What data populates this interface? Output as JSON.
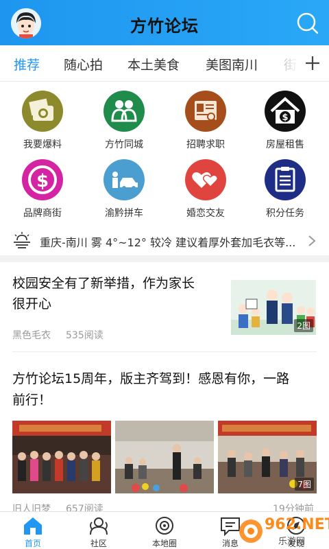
{
  "header": {
    "title": "方竹论坛"
  },
  "tabs": [
    {
      "label": "推荐",
      "active": true
    },
    {
      "label": "随心拍",
      "active": false
    },
    {
      "label": "本土美食",
      "active": false
    },
    {
      "label": "美图南川",
      "active": false
    },
    {
      "label": "街",
      "active": false
    }
  ],
  "grid": [
    {
      "label": "我要爆料",
      "icon": "camera-icon",
      "color": "#8c8a2c"
    },
    {
      "label": "方竹同城",
      "icon": "people-icon",
      "color": "#1f8c4b"
    },
    {
      "label": "招聘求职",
      "icon": "resume-icon",
      "color": "#a54e1c"
    },
    {
      "label": "房屋租售",
      "icon": "house-dollar-icon",
      "color": "#111111"
    },
    {
      "label": "品牌商街",
      "icon": "dollar-coin-icon",
      "color": "#d424a4"
    },
    {
      "label": "渝黔拼车",
      "icon": "carpool-icon",
      "color": "#4a9fd0"
    },
    {
      "label": "婚恋交友",
      "icon": "hearts-icon",
      "color": "#e0443e"
    },
    {
      "label": "积分任务",
      "icon": "task-list-icon",
      "color": "#1e2e86"
    }
  ],
  "weather": {
    "text": "重庆-南川 雾 4°~12° 较冷 建议着厚外套加毛衣等..."
  },
  "posts": [
    {
      "title_line1": "校园安全有了新举措，作为家长",
      "title_line2": "很开心",
      "author": "黑色毛衣",
      "reads": "535阅读",
      "image_count": "2图"
    },
    {
      "title_line1": "方竹论坛15周年，版主齐驾到！感恩有你，一路",
      "title_line2": "前行！",
      "author": "旧人旧梦",
      "reads": "657阅读",
      "time": "19分钟前",
      "image_count": "7图"
    }
  ],
  "bottom_nav": [
    {
      "label": "首页",
      "icon": "home-icon",
      "active": true
    },
    {
      "label": "社区",
      "icon": "community-icon",
      "active": false
    },
    {
      "label": "本地圈",
      "icon": "local-circle-icon",
      "active": false
    },
    {
      "label": "消息",
      "icon": "message-icon",
      "active": false
    },
    {
      "label": "发现",
      "icon": "discover-icon",
      "active": false
    }
  ],
  "watermark": {
    "text": "962.NET",
    "subtext": "乐游网"
  },
  "colors": {
    "accent": "#2196f3",
    "header": "#2aa8f7"
  }
}
